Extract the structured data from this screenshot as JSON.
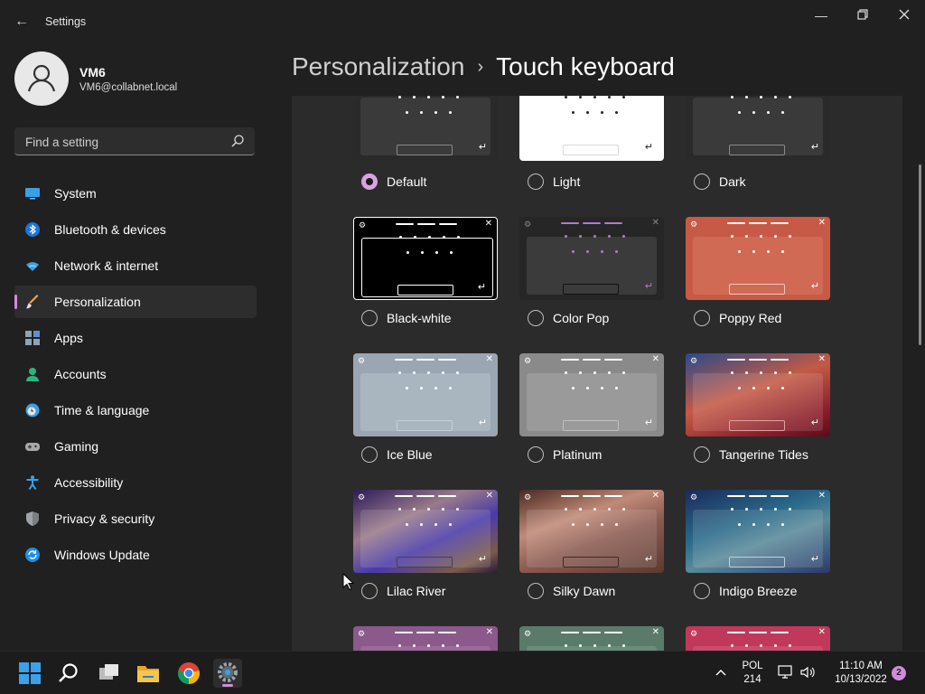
{
  "window": {
    "title": "Settings",
    "back_icon": "arrow-left-icon",
    "controls": [
      "minimize-icon",
      "maximize-icon",
      "close-icon"
    ]
  },
  "profile": {
    "name": "VM6",
    "email": "VM6@collabnet.local"
  },
  "search": {
    "placeholder": "Find a setting"
  },
  "sidebar": {
    "items": [
      {
        "label": "System",
        "icon": "monitor-icon",
        "active": false
      },
      {
        "label": "Bluetooth & devices",
        "icon": "bluetooth-icon",
        "active": false
      },
      {
        "label": "Network & internet",
        "icon": "wifi-icon",
        "active": false
      },
      {
        "label": "Personalization",
        "icon": "brush-icon",
        "active": true
      },
      {
        "label": "Apps",
        "icon": "apps-icon",
        "active": false
      },
      {
        "label": "Accounts",
        "icon": "person-icon",
        "active": false
      },
      {
        "label": "Time & language",
        "icon": "clock-globe-icon",
        "active": false
      },
      {
        "label": "Gaming",
        "icon": "gamepad-icon",
        "active": false
      },
      {
        "label": "Accessibility",
        "icon": "accessibility-icon",
        "active": false
      },
      {
        "label": "Privacy & security",
        "icon": "shield-icon",
        "active": false
      },
      {
        "label": "Windows Update",
        "icon": "update-icon",
        "active": false
      }
    ]
  },
  "header": {
    "parent": "Personalization",
    "separator": "›",
    "current": "Touch keyboard"
  },
  "themes": [
    {
      "label": "Default",
      "selected": true
    },
    {
      "label": "Light",
      "selected": false
    },
    {
      "label": "Dark",
      "selected": false
    },
    {
      "label": "Black-white",
      "selected": false
    },
    {
      "label": "Color Pop",
      "selected": false
    },
    {
      "label": "Poppy Red",
      "selected": false
    },
    {
      "label": "Ice Blue",
      "selected": false
    },
    {
      "label": "Platinum",
      "selected": false
    },
    {
      "label": "Tangerine Tides",
      "selected": false
    },
    {
      "label": "Lilac River",
      "selected": false
    },
    {
      "label": "Silky Dawn",
      "selected": false
    },
    {
      "label": "Indigo Breeze",
      "selected": false
    }
  ],
  "taskbar": {
    "apps": [
      "windows-start-icon",
      "search-icon",
      "task-view-icon",
      "file-explorer-icon",
      "chrome-icon",
      "settings-icon"
    ],
    "tray": {
      "lang_top": "POL",
      "lang_bottom": "214",
      "time": "11:10 AM",
      "date": "10/13/2022",
      "notification_count": "2"
    }
  },
  "colors": {
    "accent": "#d28bdc",
    "window_bg": "#202020",
    "content_bg": "#2b2b2b"
  }
}
